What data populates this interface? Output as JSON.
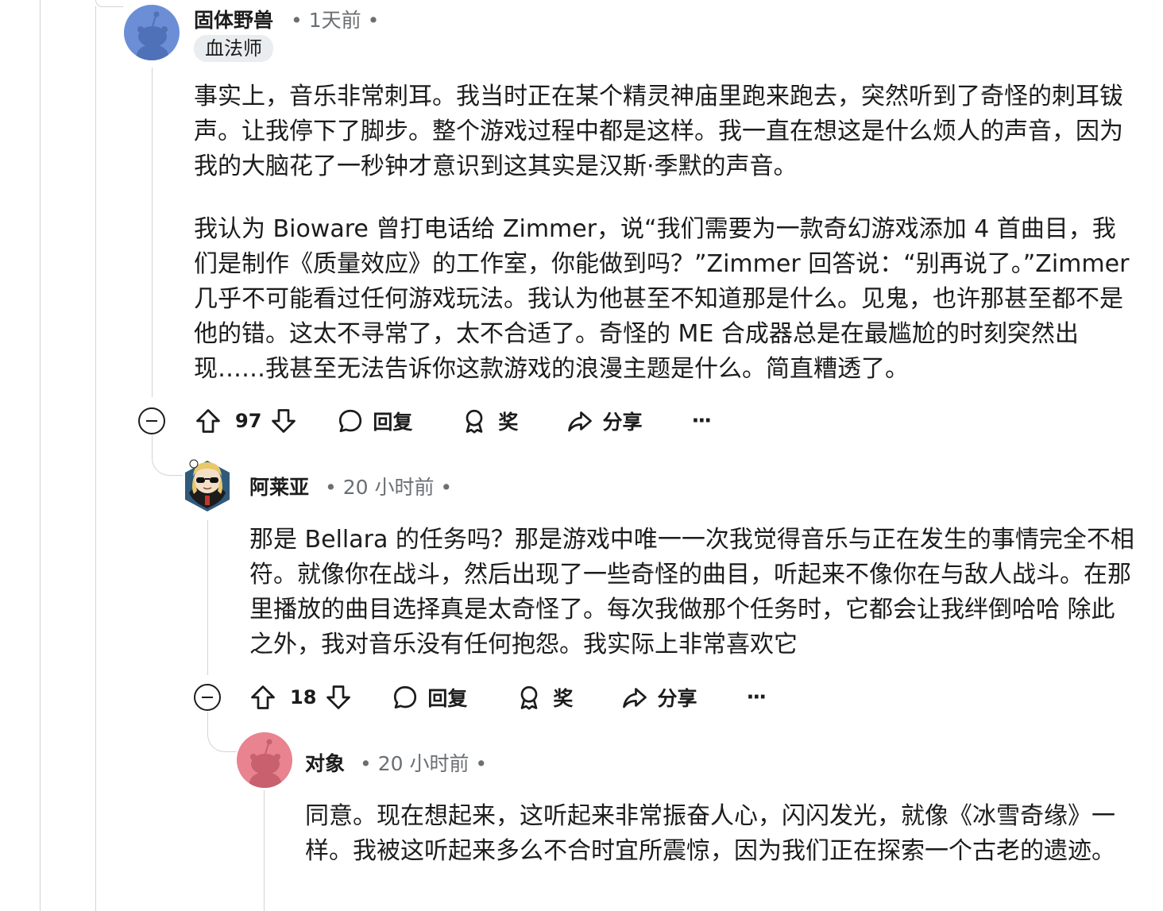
{
  "comments": [
    {
      "author": "固体野兽",
      "time": "1天前",
      "flair": "血法师",
      "paragraphs": [
        "事实上，音乐非常刺耳。我当时正在某个精灵神庙里跑来跑去，突然听到了奇怪的刺耳钹声。让我停下了脚步。整个游戏过程中都是这样。我一直在想这是什么烦人的声音，因为我的大脑花了一秒钟才意识到这其实是汉斯·季默的声音。",
        "我认为 Bioware 曾打电话给 Zimmer，说“我们需要为一款奇幻游戏添加 4 首曲目，我们是制作《质量效应》的工作室，你能做到吗？”Zimmer 回答说：“别再说了。”Zimmer 几乎不可能看过任何游戏玩法。我认为他甚至不知道那是什么。见鬼，也许那甚至都不是他的错。这太不寻常了，太不合适了。奇怪的 ME 合成器总是在最尴尬的时刻突然出现……我甚至无法告诉你这款游戏的浪漫主题是什么。简直糟透了。"
      ],
      "votes": "97",
      "avatar_color": "#6b8ed6"
    },
    {
      "author": "阿莱亚",
      "time": "20 小时前",
      "paragraphs": [
        "那是 Bellara 的任务吗？那是游戏中唯一一次我觉得音乐与正在发生的事情完全不相符。就像你在战斗，然后出现了一些奇怪的曲目，听起来不像你在与敌人战斗。在那里播放的曲目选择真是太奇怪了。每次我做那个任务时，它都会让我绊倒哈哈 除此之外，我对音乐没有任何抱怨。我实际上非常喜欢它"
      ],
      "votes": "18",
      "avatar_color": "#2f5a7c"
    },
    {
      "author": "对象",
      "time": "20 小时前",
      "paragraphs": [
        "同意。现在想起来，这听起来非常振奋人心，闪闪发光，就像《冰雪奇缘》一样。我被这听起来多么不合时宜所震惊，因为我们正在探索一个古老的遗迹。"
      ],
      "avatar_color": "#e8838f"
    }
  ],
  "actions": {
    "reply": "回复",
    "award": "奖",
    "share": "分享",
    "more": "···",
    "meta_dot": "•"
  },
  "icons": [
    "collapse-icon",
    "upvote-icon",
    "downvote-icon",
    "comment-icon",
    "award-icon",
    "share-icon",
    "more-icon",
    "snoo-avatar-icon"
  ]
}
